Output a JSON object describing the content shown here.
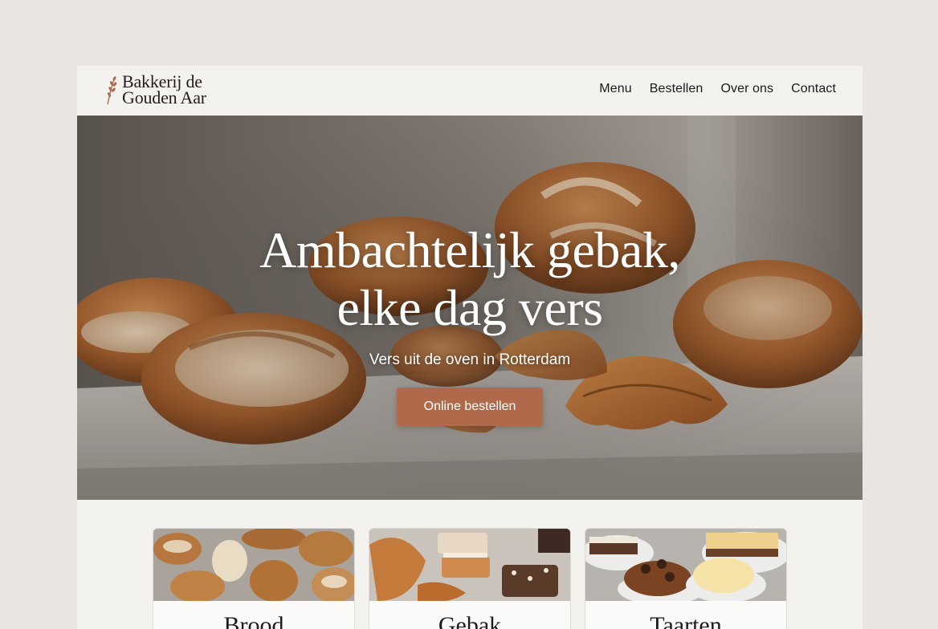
{
  "brand": {
    "name_line1": "Bakkerij de",
    "name_line2": "Gouden Aar",
    "icon": "wheat-icon"
  },
  "nav": {
    "items": [
      {
        "label": "Menu"
      },
      {
        "label": "Bestellen"
      },
      {
        "label": "Over ons"
      },
      {
        "label": "Contact"
      }
    ]
  },
  "hero": {
    "title_line1": "Ambachtelijk gebak,",
    "title_line2": "elke dag vers",
    "subtitle": "Vers uit de oven in Rotterdam",
    "cta_label": "Online bestellen"
  },
  "categories": [
    {
      "title": "Brood"
    },
    {
      "title": "Gebak"
    },
    {
      "title": "Taarten"
    }
  ],
  "colors": {
    "accent": "#b06a4b",
    "background": "#f4f2ef",
    "text": "#1c1a18"
  }
}
